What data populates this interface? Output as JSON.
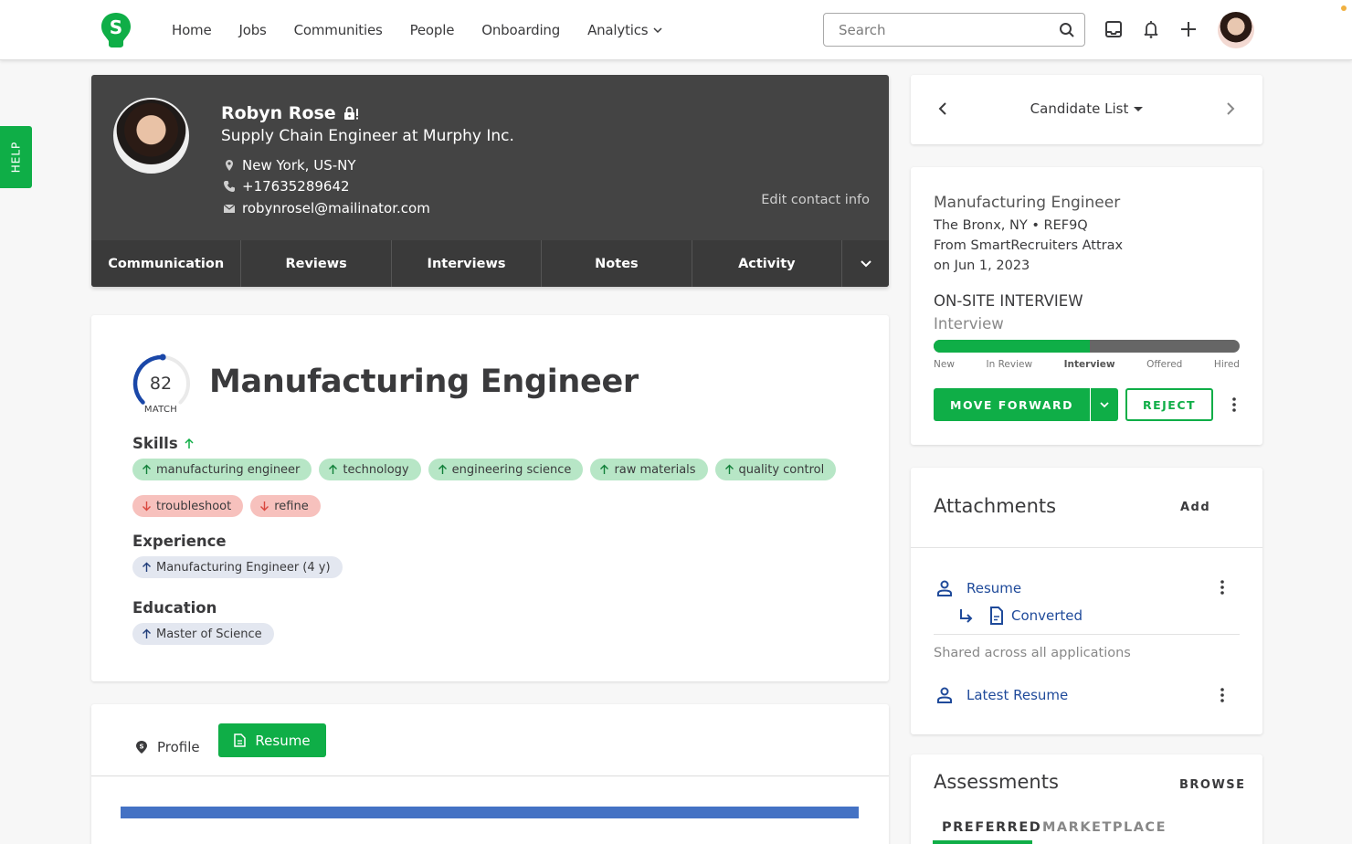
{
  "nav": {
    "links": [
      "Home",
      "Jobs",
      "Communities",
      "People",
      "Onboarding",
      "Analytics"
    ],
    "search_placeholder": "Search",
    "icons": [
      "inbox-icon",
      "bell-icon",
      "plus-icon"
    ]
  },
  "help_label": "HELP",
  "candidate": {
    "name": "Robyn Rose",
    "headline": "Supply Chain Engineer at Murphy Inc.",
    "location": "New York, US-NY",
    "phone": "+17635289642",
    "email": "robynrosel@mailinator.com",
    "edit_contact": "Edit contact info",
    "tabs": [
      "Communication",
      "Reviews",
      "Interviews",
      "Notes",
      "Activity"
    ]
  },
  "match": {
    "score": "82",
    "score_value": 82,
    "score_label": "MATCH",
    "title": "Manufacturing Engineer",
    "skills_label": "Skills",
    "skills_good": [
      "manufacturing engineer",
      "technology",
      "engineering science",
      "raw materials",
      "quality control"
    ],
    "skills_bad": [
      "troubleshoot",
      "refine"
    ],
    "experience_label": "Experience",
    "experience": [
      "Manufacturing Engineer (4 y)"
    ],
    "education_label": "Education",
    "education": [
      "Master of Science"
    ]
  },
  "resume_tabs": {
    "profile": "Profile",
    "resume": "Resume"
  },
  "navigator": {
    "label": "Candidate List"
  },
  "job": {
    "title": "Manufacturing Engineer",
    "location_ref": "The Bronx, NY  •  REF9Q",
    "source": "From SmartRecruiters Attrax",
    "date": "on Jun 1, 2023",
    "stage": "ON-SITE INTERVIEW",
    "substage": "Interview",
    "progress_percent": 51,
    "stages": [
      "New",
      "In Review",
      "Interview",
      "Offered",
      "Hired"
    ],
    "active_stage": "Interview",
    "move_forward": "MOVE FORWARD",
    "reject": "REJECT"
  },
  "attachments": {
    "title": "Attachments",
    "add": "Add",
    "resume": "Resume",
    "converted": "Converted",
    "shared": "Shared across all applications",
    "latest": "Latest Resume"
  },
  "assessments": {
    "title": "Assessments",
    "browse": "BROWSE",
    "tabs": [
      "PREFERRED",
      "MARKETPLACE"
    ]
  },
  "colors": {
    "brand_green": "#0fae47",
    "header_dark": "#444444",
    "link_blue": "#1f4a9a",
    "ring_blue": "#1a47a8"
  }
}
